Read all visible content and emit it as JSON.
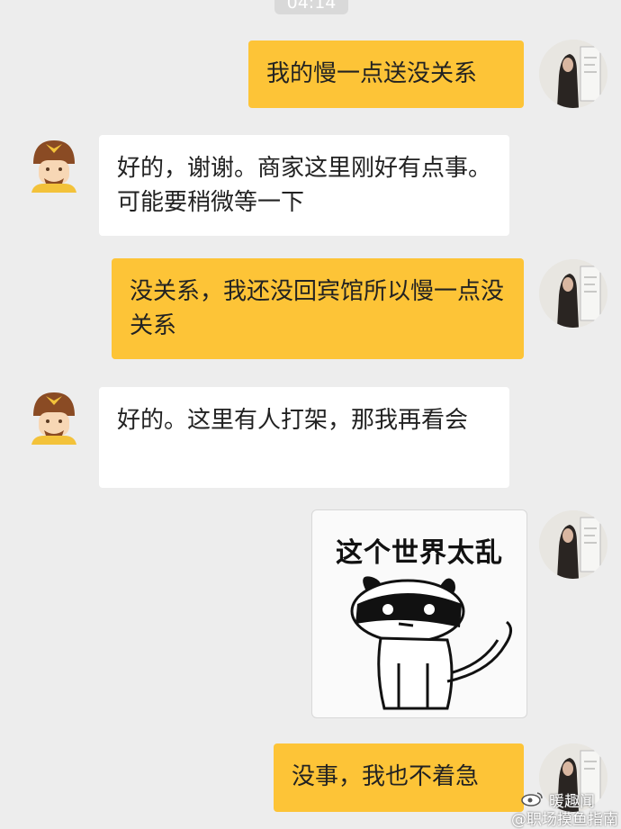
{
  "timestamp": "04:14",
  "messages": [
    {
      "side": "right",
      "text": "我的慢一点送没关系"
    },
    {
      "side": "left",
      "text": "好的，谢谢。商家这里刚好有点事。可能要稍微等一下"
    },
    {
      "side": "right",
      "text": "没关系，我还没回宾馆所以慢一点没关系"
    },
    {
      "side": "left",
      "text": "好的。这里有人打架，那我再看会"
    },
    {
      "side": "right",
      "sticker_text": "这个世界太乱"
    },
    {
      "side": "right",
      "text": "没事，我也不着急"
    }
  ],
  "watermark": {
    "line1": "暖趣闻",
    "line2": "@职场摸鱼指南"
  },
  "colors": {
    "background": "#ededed",
    "outgoing_bubble": "#fdc437",
    "incoming_bubble": "#ffffff"
  },
  "icons": {
    "rider_avatar": "delivery-rider-avatar",
    "user_avatar": "user-photo-avatar"
  }
}
